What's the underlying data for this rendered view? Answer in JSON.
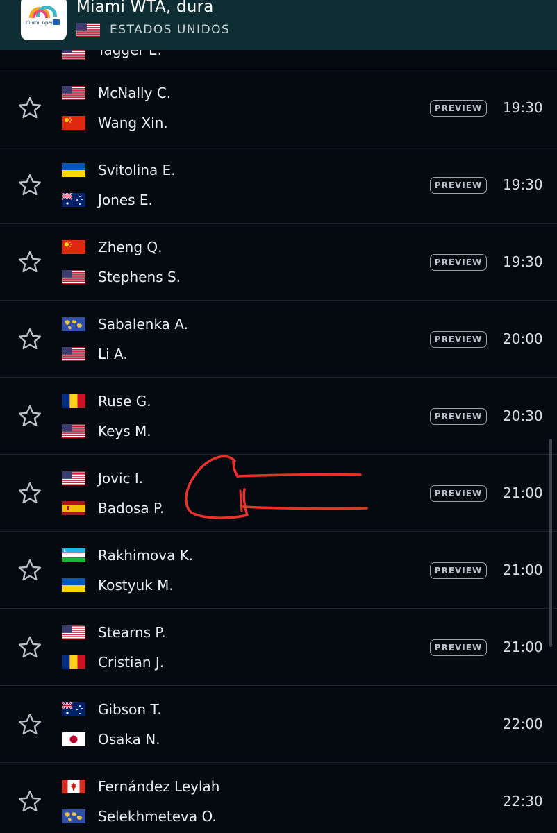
{
  "header": {
    "title": "Miami WTA, dura",
    "country": "ESTADOS UNIDOS",
    "logo_text": "miami open"
  },
  "partial_row": {
    "name": "Yagger E.",
    "flag": "us"
  },
  "matches": [
    {
      "p1": "McNally C.",
      "f1": "us",
      "p2": "Wang Xin.",
      "f2": "cn",
      "preview": "PREVIEW",
      "time": "19:30"
    },
    {
      "p1": "Svitolina E.",
      "f1": "ua",
      "p2": "Jones E.",
      "f2": "au",
      "preview": "PREVIEW",
      "time": "19:30"
    },
    {
      "p1": "Zheng Q.",
      "f1": "cn",
      "p2": "Stephens S.",
      "f2": "us",
      "preview": "PREVIEW",
      "time": "19:30"
    },
    {
      "p1": "Sabalenka A.",
      "f1": "world",
      "p2": "Li A.",
      "f2": "us",
      "preview": "PREVIEW",
      "time": "20:00"
    },
    {
      "p1": "Ruse G.",
      "f1": "ro",
      "p2": "Keys M.",
      "f2": "us",
      "preview": "PREVIEW",
      "time": "20:30"
    },
    {
      "p1": "Jovic I.",
      "f1": "us",
      "p2": "Badosa P.",
      "f2": "es",
      "preview": "PREVIEW",
      "time": "21:00"
    },
    {
      "p1": "Rakhimova K.",
      "f1": "uz",
      "p2": "Kostyuk M.",
      "f2": "ua",
      "preview": "PREVIEW",
      "time": "21:00"
    },
    {
      "p1": "Stearns P.",
      "f1": "us",
      "p2": "Cristian J.",
      "f2": "ro",
      "preview": "PREVIEW",
      "time": "21:00"
    },
    {
      "p1": "Gibson T.",
      "f1": "au",
      "p2": "Osaka N.",
      "f2": "jp",
      "preview": "",
      "time": "22:00"
    },
    {
      "p1": "Fernández Leylah",
      "f1": "ca",
      "p2": "Selekhmeteva O.",
      "f2": "world",
      "preview": "",
      "time": "22:30"
    }
  ],
  "icons": {
    "favorite": "star-outline-icon"
  },
  "colors": {
    "header_bg": "#0f2e33",
    "page_bg": "#050a10",
    "annotation": "#e8332a"
  }
}
